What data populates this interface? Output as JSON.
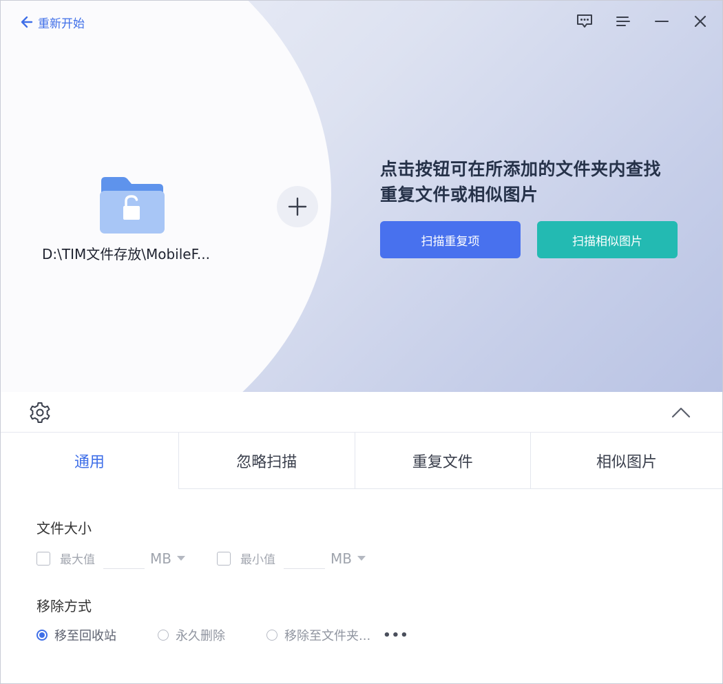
{
  "header": {
    "back_label": "重新开始",
    "icons": [
      "feedback-icon",
      "menu-icon",
      "minimize-icon",
      "close-icon"
    ]
  },
  "hero": {
    "folder_path": "D:\\TIM文件存放\\MobileF...",
    "prompt_line1": "点击按钮可在所添加的文件夹内查找",
    "prompt_line2": "重复文件或相似图片",
    "scan_duplicates_label": "扫描重复项",
    "scan_similar_label": "扫描相似图片"
  },
  "tabs": [
    {
      "label": "通用",
      "active": true
    },
    {
      "label": "忽略扫描",
      "active": false
    },
    {
      "label": "重复文件",
      "active": false
    },
    {
      "label": "相似图片",
      "active": false
    }
  ],
  "general": {
    "file_size": {
      "title": "文件大小",
      "max_label": "最大值",
      "max_value": "",
      "max_unit": "MB",
      "min_label": "最小值",
      "min_value": "",
      "min_unit": "MB"
    },
    "removal": {
      "title": "移除方式",
      "options": [
        {
          "label": "移至回收站",
          "selected": true
        },
        {
          "label": "永久删除",
          "selected": false
        },
        {
          "label": "移除至文件夹...",
          "selected": false
        }
      ],
      "more_label": "•••"
    }
  },
  "colors": {
    "accent_blue": "#4871ee",
    "accent_teal": "#23bab2",
    "link_blue": "#3f6fe8"
  }
}
